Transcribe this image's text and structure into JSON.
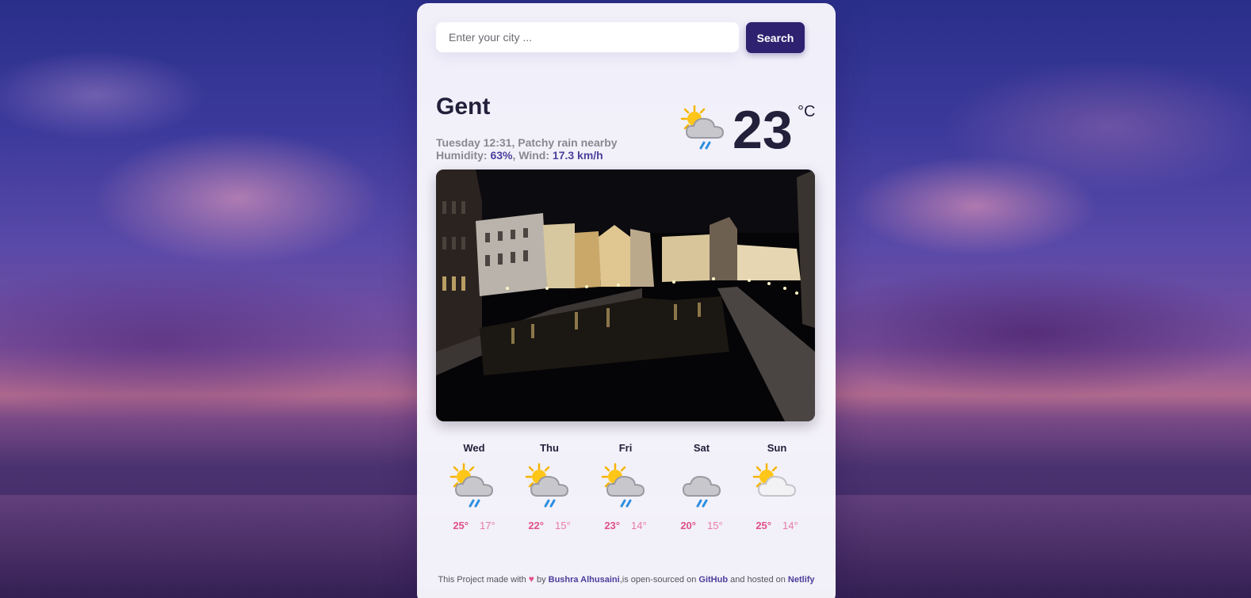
{
  "search": {
    "placeholder": "Enter your city ...",
    "value": "",
    "button_label": "Search"
  },
  "current": {
    "city": "Gent",
    "day_time": "Tuesday 12:31",
    "description": "Patchy rain nearby",
    "humidity_label": "Humidity:",
    "humidity_value": "63%",
    "wind_label": "Wind:",
    "wind_value": "17.3 km/h",
    "temperature": "23",
    "unit": "°C",
    "icon": "partly-cloudy-rain-icon"
  },
  "city_image": {
    "alt": "Night view of Gent canal"
  },
  "forecast": [
    {
      "day": "Wed",
      "max": "25°",
      "min": "17°",
      "icon": "partly-cloudy-rain-icon"
    },
    {
      "day": "Thu",
      "max": "22°",
      "min": "15°",
      "icon": "partly-cloudy-rain-icon"
    },
    {
      "day": "Fri",
      "max": "23°",
      "min": "14°",
      "icon": "partly-cloudy-rain-icon"
    },
    {
      "day": "Sat",
      "max": "20°",
      "min": "15°",
      "icon": "cloud-rain-icon"
    },
    {
      "day": "Sun",
      "max": "25°",
      "min": "14°",
      "icon": "partly-cloudy-icon"
    }
  ],
  "footer": {
    "text1": "This Project made with",
    "text2": "by",
    "author": "Bushra Alhusaini",
    "text3": ",is open-sourced on",
    "github": "GitHub",
    "text4": "and hosted on",
    "netlify": "Netlify"
  },
  "colors": {
    "accent": "#2e216f",
    "highlight": "#4b3f9c",
    "max_temp": "#e0508c",
    "min_temp": "#e87aa8"
  }
}
